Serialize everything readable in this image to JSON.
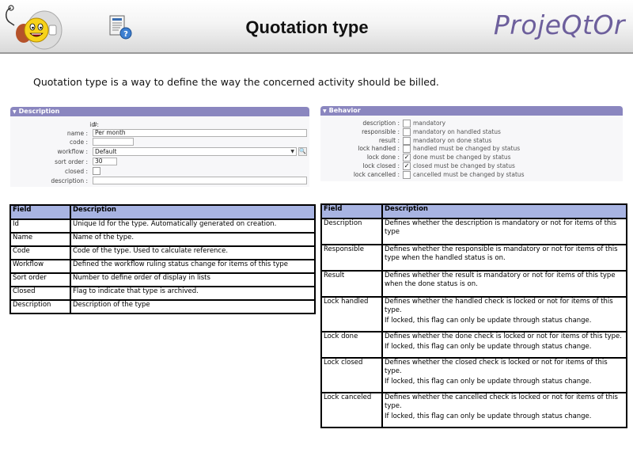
{
  "header": {
    "title": "Quotation type",
    "brand": "ProjeQtOr",
    "mascot_icon": "smiley-mascot-icon",
    "help_icon": "help-document-icon"
  },
  "intro": "Quotation type is a way to define the way the concerned activity should be billed.",
  "description_panel": {
    "title": "Description",
    "fields": {
      "id": {
        "label": "id :",
        "value": "# 94"
      },
      "name": {
        "label": "name :",
        "value": "Per month"
      },
      "code": {
        "label": "code :",
        "value": ""
      },
      "workflow": {
        "label": "workflow :",
        "value": "Default"
      },
      "sort_order": {
        "label": "sort order :",
        "value": "30"
      },
      "closed": {
        "label": "closed :",
        "checked": false
      },
      "description": {
        "label": "description :",
        "value": ""
      }
    }
  },
  "behavior_panel": {
    "title": "Behavior",
    "rows": [
      {
        "label": "description :",
        "checked": false,
        "text": "mandatory"
      },
      {
        "label": "responsible :",
        "checked": false,
        "text": "mandatory on handled status"
      },
      {
        "label": "result :",
        "checked": false,
        "text": "mandatory on done status"
      },
      {
        "label": "lock handled :",
        "checked": false,
        "text": "handled must be changed by status"
      },
      {
        "label": "lock done :",
        "checked": true,
        "text": "done must be changed by status"
      },
      {
        "label": "lock closed :",
        "checked": true,
        "text": "closed must be changed by status"
      },
      {
        "label": "lock cancelled :",
        "checked": false,
        "text": "cancelled must be changed by status"
      }
    ]
  },
  "left_table": {
    "headers": [
      "Field",
      "Description"
    ],
    "rows": [
      [
        "Id",
        "Unique Id for the type. Automatically generated on creation."
      ],
      [
        "Name",
        "Name of the type."
      ],
      [
        "Code",
        "Code of the type. Used to calculate reference."
      ],
      [
        "Workflow",
        "Defined the workflow ruling status change for items of this type"
      ],
      [
        "Sort order",
        "Number to define order of display in lists"
      ],
      [
        "Closed",
        "Flag to indicate that type is archived."
      ],
      [
        "Description",
        "Description of the type"
      ]
    ]
  },
  "right_table": {
    "headers": [
      "Field",
      "Description"
    ],
    "rows": [
      {
        "field": "Description",
        "lines": [
          "Defines whether the description is mandatory or not for items of this type"
        ]
      },
      {
        "field": "Responsible",
        "lines": [
          "Defines whether the responsible is mandatory or not for items of this type when the handled status is on."
        ]
      },
      {
        "field": "Result",
        "lines": [
          "Defines whether the result is mandatory or not for items of this type when the done status is on."
        ]
      },
      {
        "field": "Lock handled",
        "lines": [
          "Defines whether the handled check is locked or not for items of this type.",
          "If locked, this flag can only be update through status change."
        ]
      },
      {
        "field": "Lock done",
        "lines": [
          "Defines whether the done check is locked or not for items of this type.",
          "If locked, this flag can only be update through status change."
        ]
      },
      {
        "field": "Lock closed",
        "lines": [
          "Defines whether the closed check is locked or not for items of this type.",
          "If locked, this flag can only be update through status change."
        ]
      },
      {
        "field": "Lock canceled",
        "lines": [
          "Defines whether the cancelled check is locked or not for items of this type.",
          "If locked, this flag can only be update through status change."
        ]
      }
    ]
  }
}
